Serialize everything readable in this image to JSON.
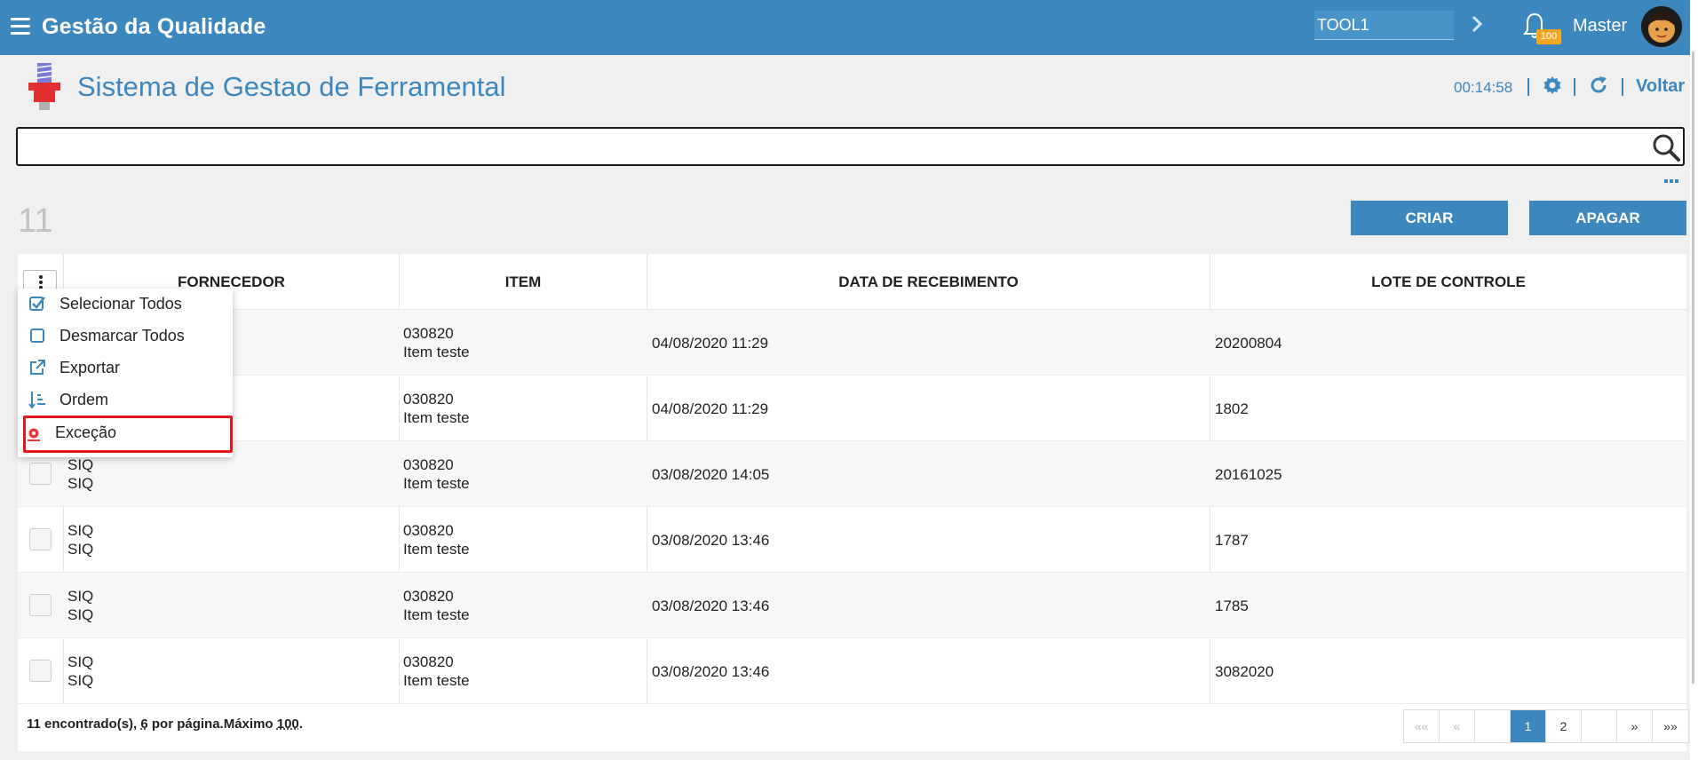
{
  "header": {
    "app_title": "Gestão da Qualidade",
    "tool_field_value": "TOOL1",
    "notification_count": "100",
    "user_name": "Master"
  },
  "subheader": {
    "page_title": "Sistema de Gestao de Ferramental",
    "timer": "00:14:58",
    "back_label": "Voltar"
  },
  "search": {
    "value": "",
    "placeholder": ""
  },
  "toolbar": {
    "record_count": "11",
    "create_label": "CRIAR",
    "delete_label": "APAGAR"
  },
  "table": {
    "columns": [
      "FORNECEDOR",
      "ITEM",
      "DATA DE RECEBIMENTO",
      "LOTE DE CONTROLE"
    ],
    "rows": [
      {
        "fornecedor_1": "",
        "fornecedor_2": "",
        "item_code": "030820",
        "item_name": "Item teste",
        "data": "04/08/2020 11:29",
        "lote": "20200804"
      },
      {
        "fornecedor_1": "",
        "fornecedor_2": "",
        "item_code": "030820",
        "item_name": "Item teste",
        "data": "04/08/2020 11:29",
        "lote": "1802"
      },
      {
        "fornecedor_1": "SIQ",
        "fornecedor_2": "SIQ",
        "item_code": "030820",
        "item_name": "Item teste",
        "data": "03/08/2020 14:05",
        "lote": "20161025"
      },
      {
        "fornecedor_1": "SIQ",
        "fornecedor_2": "SIQ",
        "item_code": "030820",
        "item_name": "Item teste",
        "data": "03/08/2020 13:46",
        "lote": "1787"
      },
      {
        "fornecedor_1": "SIQ",
        "fornecedor_2": "SIQ",
        "item_code": "030820",
        "item_name": "Item teste",
        "data": "03/08/2020 13:46",
        "lote": "1785"
      },
      {
        "fornecedor_1": "SIQ",
        "fornecedor_2": "SIQ",
        "item_code": "030820",
        "item_name": "Item teste",
        "data": "03/08/2020 13:46",
        "lote": "3082020"
      }
    ]
  },
  "footer": {
    "found_count": "11",
    "found_label": " encontrado(s), ",
    "per_page": "6",
    "per_page_label": " por página.Máximo ",
    "max": "100",
    "end": "."
  },
  "pagination": {
    "first": "««",
    "prev": "«",
    "pages": [
      "1",
      "2"
    ],
    "current": "1",
    "next": "»",
    "last": "»»"
  },
  "dropdown_menu": {
    "items": [
      {
        "label": "Selecionar Todos",
        "icon": "check-square-icon"
      },
      {
        "label": "Desmarcar Todos",
        "icon": "square-icon"
      },
      {
        "label": "Exportar",
        "icon": "external-link-icon"
      },
      {
        "label": "Ordem",
        "icon": "sort-icon"
      },
      {
        "label": "Exceção",
        "icon": "exception-icon"
      }
    ],
    "highlighted": "Exceção"
  },
  "colors": {
    "primary": "#3b87be",
    "badge": "#f5a623",
    "highlight_border": "#e0191f",
    "background": "#f0f0f0"
  }
}
